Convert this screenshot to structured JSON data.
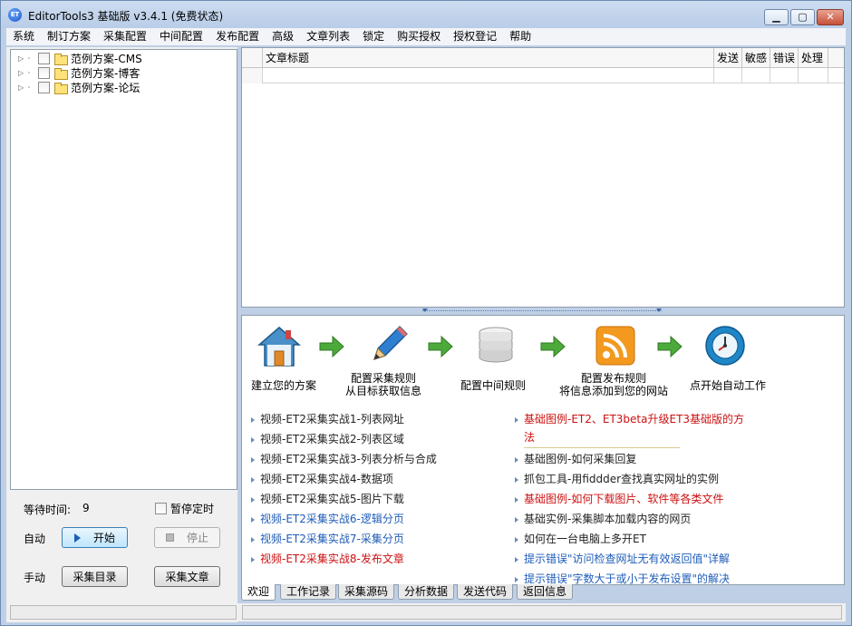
{
  "window": {
    "title": "EditorTools3 基础版 v3.4.1 (免费状态)",
    "icon_text": "ET"
  },
  "menu": [
    "系统",
    "制订方案",
    "采集配置",
    "中间配置",
    "发布配置",
    "高级",
    "文章列表",
    "锁定",
    "购买授权",
    "授权登记",
    "帮助"
  ],
  "tree": {
    "items": [
      {
        "label": "范例方案-CMS"
      },
      {
        "label": "范例方案-博客"
      },
      {
        "label": "范例方案-论坛"
      }
    ]
  },
  "controls": {
    "wait_label": "等待时间:",
    "wait_value": "9",
    "pause_label": "暂停定时",
    "auto_label": "自动",
    "start_button": "开始",
    "stop_button": "停止",
    "manual_label": "手动",
    "collect_dir_button": "采集目录",
    "collect_article_button": "采集文章"
  },
  "grid": {
    "columns": [
      "文章标题",
      "发送",
      "敏感",
      "错误",
      "处理"
    ]
  },
  "welcome": {
    "steps": [
      {
        "line1": "建立您的方案",
        "line2": ""
      },
      {
        "line1": "配置采集规则",
        "line2": "从目标获取信息"
      },
      {
        "line1": "配置中间规则",
        "line2": ""
      },
      {
        "line1": "配置发布规则",
        "line2": "将信息添加到您的网站"
      },
      {
        "line1": "点开始自动工作",
        "line2": ""
      }
    ],
    "links_left": [
      {
        "text": "视频-ET2采集实战1-列表网址",
        "color": "black"
      },
      {
        "text": "视频-ET2采集实战2-列表区域",
        "color": "black"
      },
      {
        "text": "视频-ET2采集实战3-列表分析与合成",
        "color": "black"
      },
      {
        "text": "视频-ET2采集实战4-数据项",
        "color": "black"
      },
      {
        "text": "视频-ET2采集实战5-图片下载",
        "color": "black"
      },
      {
        "text": "视频-ET2采集实战6-逻辑分页",
        "color": "blue"
      },
      {
        "text": "视频-ET2采集实战7-采集分页",
        "color": "blue"
      },
      {
        "text": "视频-ET2采集实战8-发布文章",
        "color": "red"
      }
    ],
    "links_right": [
      {
        "text": "基础图例-ET2、ET3beta升级ET3基础版的方",
        "cont": "法",
        "color": "red"
      },
      {
        "text": "基础图例-如何采集回复",
        "color": "black"
      },
      {
        "text": "抓包工具-用fiddder查找真实网址的实例",
        "color": "black"
      },
      {
        "text": "基础图例-如何下载图片、软件等各类文件",
        "color": "red"
      },
      {
        "text": "基础实例-采集脚本加载内容的网页",
        "color": "black"
      },
      {
        "text": "如何在一台电脑上多开ET",
        "color": "black"
      },
      {
        "text": "提示错误\"访问检查网址无有效返回值\"详解",
        "color": "blue"
      },
      {
        "text": "提示错误\"字数大于或小于发布设置\"的解决",
        "color": "blue"
      }
    ]
  },
  "tabs": [
    "欢迎",
    "工作记录",
    "采集源码",
    "分析数据",
    "发送代码",
    "返回信息"
  ],
  "colors": {
    "link_red": "#cc1111",
    "link_blue": "#1e5cb8",
    "arrow_green": "#4caa3a"
  }
}
